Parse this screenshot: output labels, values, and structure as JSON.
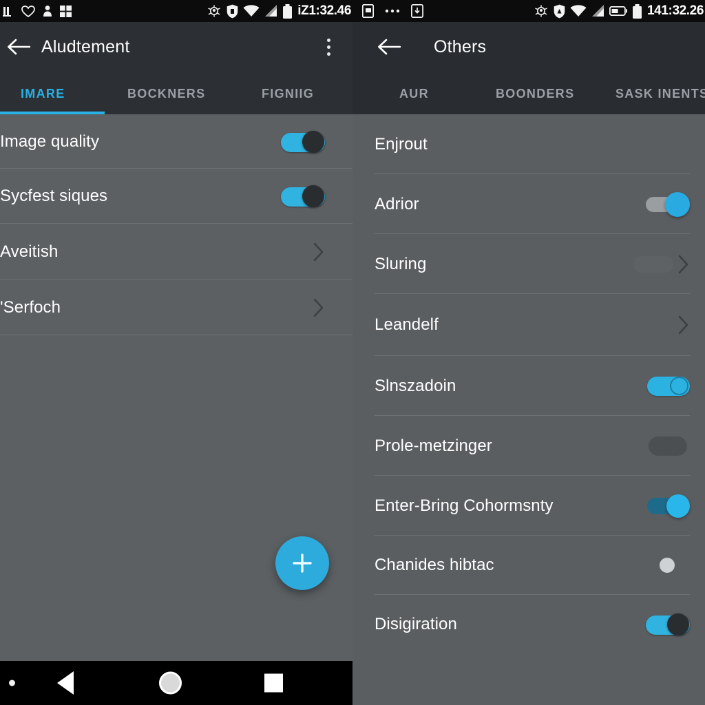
{
  "statusbar": {
    "left": {
      "icons": [
        "signal-bars-icon",
        "heart-activity-icon",
        "person-icon",
        "grid-icon",
        "bug-icon",
        "shield-icon",
        "wifi-icon",
        "cell-signal-icon",
        "battery-icon"
      ],
      "clock": "iZ1:32.46"
    },
    "right": {
      "icons": [
        "sim-card-icon",
        "more-horizontal-icon",
        "screenshot-icon",
        "bug-icon",
        "shield-icon",
        "wifi-icon",
        "cell-signal-icon",
        "battery-horizontal-icon",
        "battery-icon"
      ],
      "clock": "141:32.26"
    }
  },
  "left_panel": {
    "appbar": {
      "back_icon": "arrow-left-icon",
      "title": "Aludtement",
      "overflow_icon": "overflow-menu-icon"
    },
    "tabs": [
      {
        "label": "IMARE",
        "active": true
      },
      {
        "label": "BOCKNERS",
        "active": false
      },
      {
        "label": "FIGNIIG",
        "active": false
      }
    ],
    "rows": [
      {
        "label": "Image quality",
        "control": "toggle-on-dark-thumb"
      },
      {
        "label": "Sycfest siques",
        "control": "toggle-on-dark-thumb"
      },
      {
        "label": "Aveitish",
        "control": "chevron"
      },
      {
        "label": "'Serfoch",
        "control": "chevron"
      }
    ],
    "fab": {
      "icon": "plus-icon",
      "label": "+"
    },
    "navbar": {
      "items": [
        "status-dot",
        "back-triangle-icon",
        "home-circle-icon",
        "recents-square-icon"
      ]
    }
  },
  "right_panel": {
    "appbar": {
      "back_icon": "arrow-left-icon",
      "title": "Others"
    },
    "tabs": [
      {
        "label": "AUR",
        "active": false
      },
      {
        "label": "BOONDERS",
        "active": false
      },
      {
        "label": "SASK INENTS",
        "active": false
      }
    ],
    "rows": [
      {
        "label": "Enjrout",
        "control": "none"
      },
      {
        "label": "Adrior",
        "control": "toggle-grey-track-cyan-thumb"
      },
      {
        "label": "Sluring",
        "control": "ghost-pill-chevron"
      },
      {
        "label": "Leandelf",
        "control": "chevron"
      },
      {
        "label": "Slnszadoin",
        "control": "toggle-cyan-ring-thumb"
      },
      {
        "label": "Prole-metzinger",
        "control": "toggle-off-dark-pill"
      },
      {
        "label": "Enter-Bring Cohormsnty",
        "control": "toggle-teal-track-cyan-thumb"
      },
      {
        "label": "Chanides hibtac",
        "control": "small-light-dot"
      },
      {
        "label": "Disigiration",
        "control": "toggle-on-dark-thumb"
      }
    ]
  },
  "colors": {
    "accent": "#29b0e4",
    "appbar_bg": "#2c3034",
    "list_bg": "#5c6063",
    "statusbar_bg": "#0c0c0c",
    "navbar_bg": "#000000",
    "text_primary": "#ffffff",
    "tab_inactive": "#9aa0a6"
  }
}
